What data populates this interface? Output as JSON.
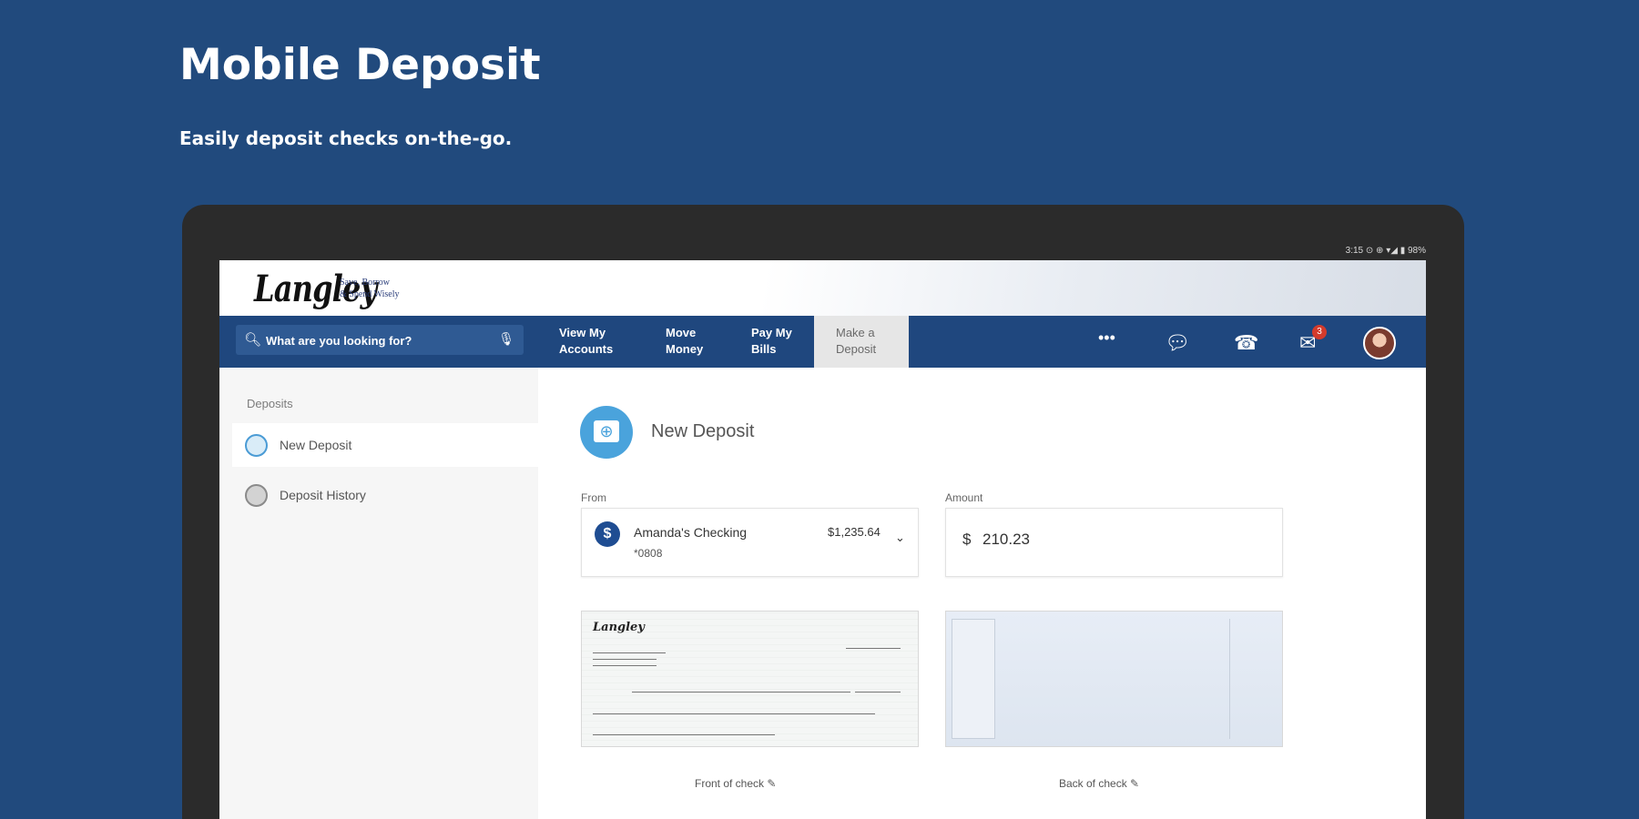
{
  "page": {
    "headline": "Mobile Deposit",
    "subline": "Easily deposit checks on-the-go."
  },
  "statusbar": {
    "text": "3:15 ⊙ ⊕ ▾◢ ▮ 98%"
  },
  "brand": {
    "logo": "Langley",
    "tagline_line1": "Save, Borrow",
    "tagline_line2": "& Spend Wisely"
  },
  "nav": {
    "search_placeholder": "What are you looking for?",
    "items": [
      {
        "label": "View My\nAccounts"
      },
      {
        "label": "Move\nMoney"
      },
      {
        "label": "Pay My\nBills"
      },
      {
        "label": "Make a\nDeposit"
      }
    ],
    "mail_badge": "3",
    "icons": [
      "search-icon",
      "microphone-icon",
      "more-icon",
      "chat-icon",
      "phone-icon",
      "mail-icon",
      "avatar"
    ]
  },
  "sidebar": {
    "title": "Deposits",
    "items": [
      {
        "label": "New Deposit"
      },
      {
        "label": "Deposit History"
      }
    ]
  },
  "deposit": {
    "title": "New Deposit",
    "from_label": "From",
    "account_name": "Amanda's Checking",
    "account_number": "*0808",
    "account_balance": "$1,235.64",
    "amount_label": "Amount",
    "amount_currency": "$",
    "amount_value": "210.23",
    "front_caption": "Front of check",
    "back_caption": "Back of check"
  },
  "colors": {
    "background": "#214a7d",
    "nav": "#1f477e",
    "accent": "#4aa3dc",
    "badge": "#d33b2c"
  }
}
